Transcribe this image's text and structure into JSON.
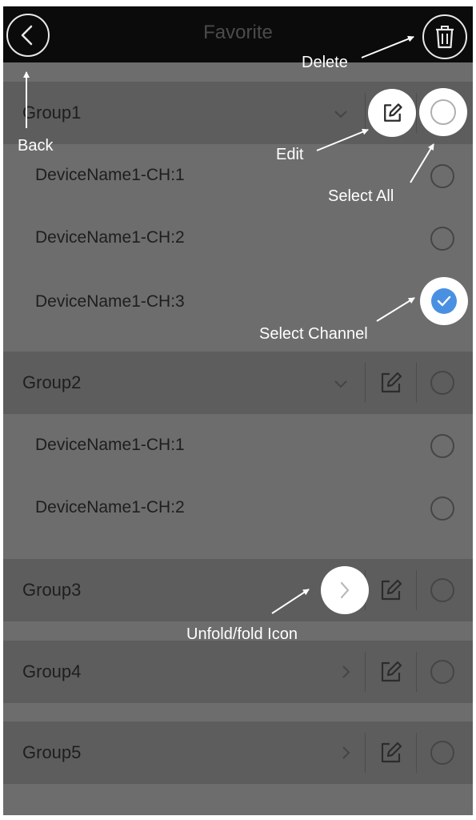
{
  "navbar": {
    "title": "Favorite",
    "back_icon": "chevron-left-icon",
    "delete_icon": "trash-icon"
  },
  "groups": [
    {
      "label": "Group1",
      "expanded": true,
      "channels": [
        "DeviceName1-CH:1",
        "DeviceName1-CH:2",
        "DeviceName1-CH:3"
      ]
    },
    {
      "label": "Group2",
      "expanded": true,
      "channels": [
        "DeviceName1-CH:1",
        "DeviceName1-CH:2"
      ]
    },
    {
      "label": "Group3",
      "expanded": false,
      "channels": []
    },
    {
      "label": "Group4",
      "expanded": false,
      "channels": []
    },
    {
      "label": "Group5",
      "expanded": false,
      "channels": []
    }
  ],
  "selected_channel": "Group1 / DeviceName1-CH:3",
  "annotations": {
    "back": "Back",
    "delete": "Delete",
    "edit": "Edit",
    "select_all": "Select All",
    "select_channel": "Select Channel",
    "unfold_fold": "Unfold/fold Icon"
  },
  "colors": {
    "overlay": "#6d6d6d",
    "row": "#5d5d5d",
    "navbar": "#0b0b0b",
    "check": "#4a90e2",
    "annotation": "#ffffff"
  }
}
